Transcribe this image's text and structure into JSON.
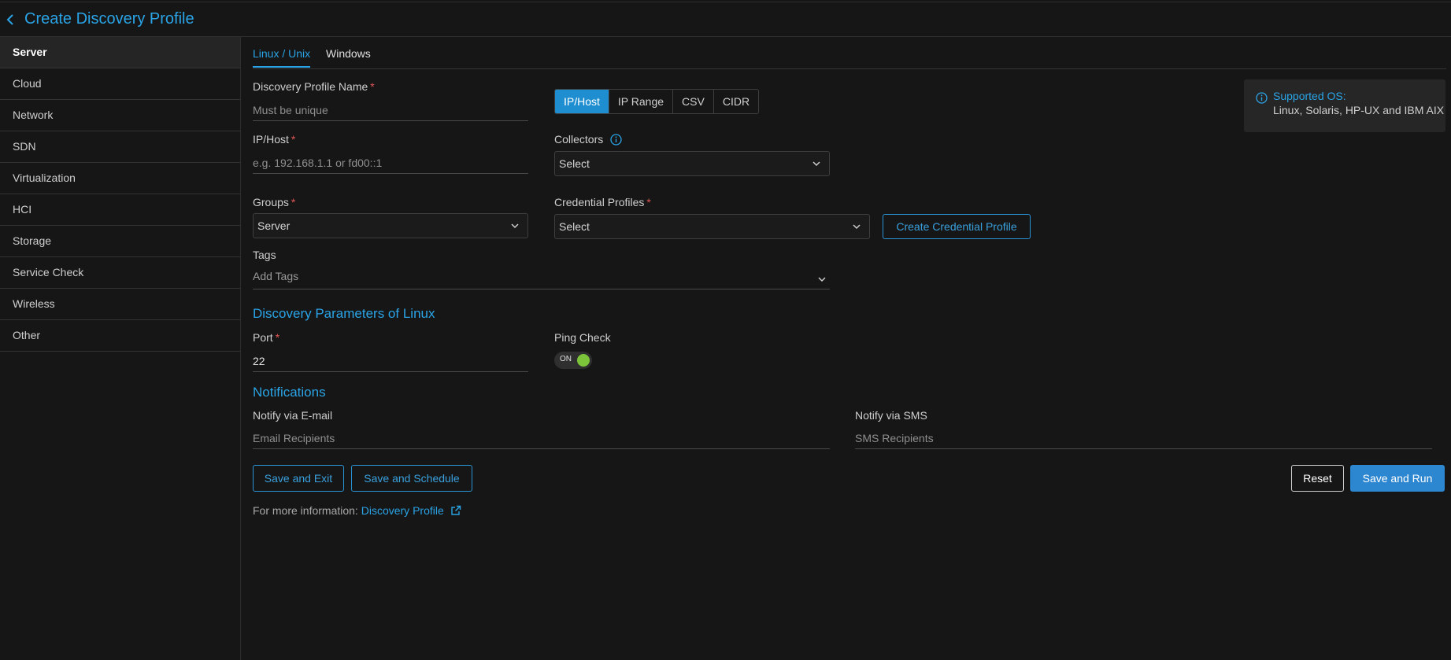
{
  "header": {
    "title": "Create Discovery Profile"
  },
  "sidebar": {
    "items": [
      {
        "label": "Server"
      },
      {
        "label": "Cloud"
      },
      {
        "label": "Network"
      },
      {
        "label": "SDN"
      },
      {
        "label": "Virtualization"
      },
      {
        "label": "HCI"
      },
      {
        "label": "Storage"
      },
      {
        "label": "Service Check"
      },
      {
        "label": "Wireless"
      },
      {
        "label": "Other"
      }
    ],
    "active": "Server"
  },
  "tabs": [
    {
      "label": "Linux / Unix",
      "active": true
    },
    {
      "label": "Windows",
      "active": false
    }
  ],
  "form": {
    "profile_name_label": "Discovery Profile Name",
    "profile_name_placeholder": "Must be unique",
    "segment_options": [
      "IP/Host",
      "IP Range",
      "CSV",
      "CIDR"
    ],
    "segment_selected": "IP/Host",
    "ip_host_label": "IP/Host",
    "ip_host_placeholder": "e.g. 192.168.1.1 or fd00::1",
    "collectors_label": "Collectors",
    "collectors_value": "Select",
    "groups_label": "Groups",
    "groups_value": "Server",
    "credential_label": "Credential Profiles",
    "credential_value": "Select",
    "create_credential_button": "Create Credential Profile",
    "tags_label": "Tags",
    "tags_placeholder": "Add Tags",
    "required_mark": "*"
  },
  "info": {
    "title": "Supported OS:",
    "text": "Linux, Solaris, HP-UX and IBM AIX"
  },
  "discovery_params": {
    "title": "Discovery Parameters of Linux",
    "port_label": "Port",
    "port_value": "22",
    "ping_label": "Ping Check",
    "ping_state": "ON"
  },
  "notifications": {
    "title": "Notifications",
    "email_label": "Notify via E-mail",
    "email_placeholder": "Email Recipients",
    "sms_label": "Notify via SMS",
    "sms_placeholder": "SMS Recipients"
  },
  "actions": {
    "save_exit": "Save and Exit",
    "save_schedule": "Save and Schedule",
    "reset": "Reset",
    "save_run": "Save and Run"
  },
  "footer": {
    "info_text": "For more information:",
    "link_text": "Discovery Profile"
  },
  "colors": {
    "accent": "#2aa4e6",
    "primary_button": "#2d86d0",
    "toggle_on": "#7cc43a",
    "required": "#e05555",
    "background": "#161616"
  }
}
